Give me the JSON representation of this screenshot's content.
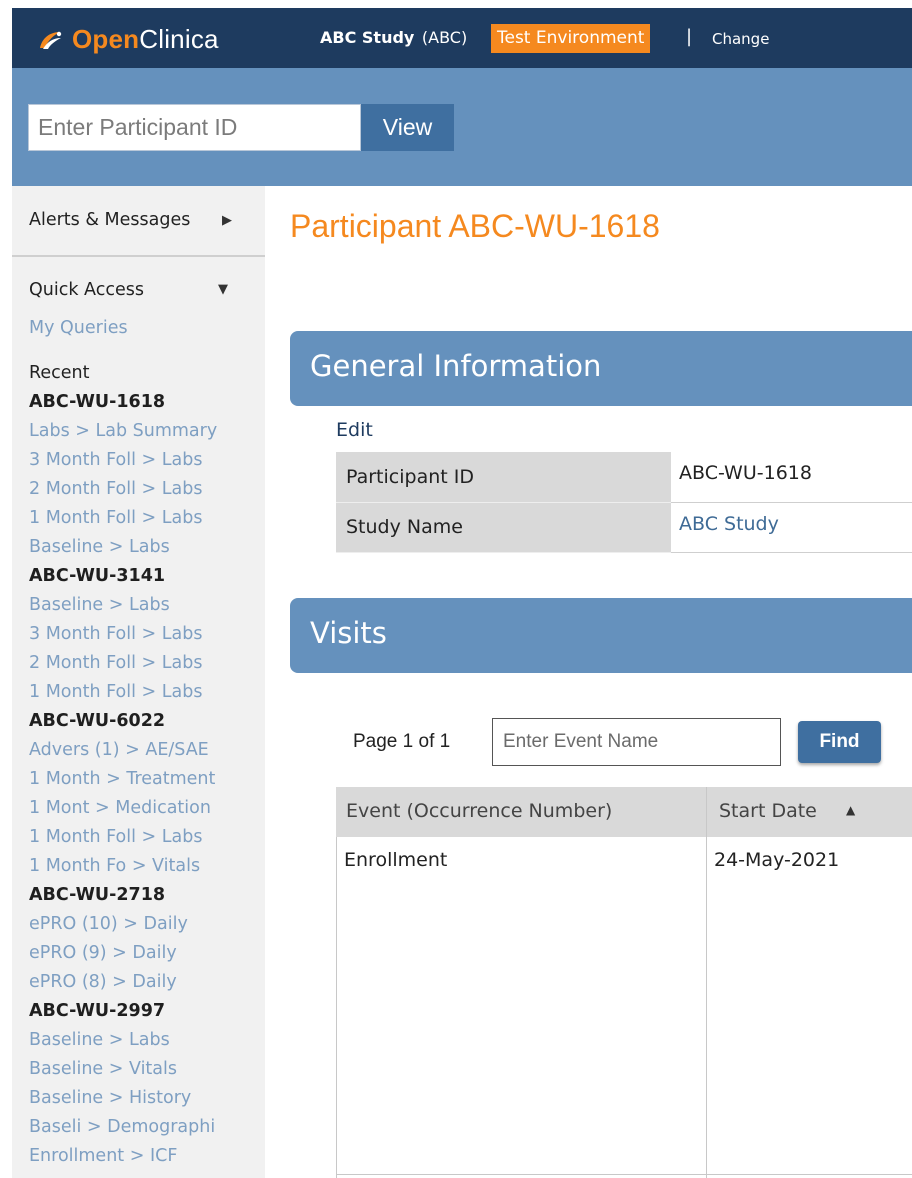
{
  "header": {
    "logo_open": "Open",
    "logo_clinica": "Clinica",
    "study_name": "ABC Study",
    "study_code": "(ABC)",
    "environment": "Test Environment",
    "separator": "|",
    "change_label": "Change",
    "bar_color": "#1e3b5f",
    "accent_color": "#f5891f"
  },
  "search": {
    "placeholder": "Enter Participant ID",
    "value": "",
    "view_label": "View"
  },
  "sidebar": {
    "alerts_label": "Alerts & Messages",
    "quick_access_label": "Quick Access",
    "my_queries_label": "My Queries",
    "recent_label": "Recent",
    "recent": [
      {
        "type": "head",
        "text": "ABC-WU-1618"
      },
      {
        "type": "link",
        "text": "Labs > Lab Summary"
      },
      {
        "type": "link",
        "text": "3 Month Foll > Labs"
      },
      {
        "type": "link",
        "text": "2 Month Foll > Labs"
      },
      {
        "type": "link",
        "text": "1 Month Foll > Labs"
      },
      {
        "type": "link",
        "text": "Baseline > Labs"
      },
      {
        "type": "head",
        "text": "ABC-WU-3141"
      },
      {
        "type": "link",
        "text": "Baseline > Labs"
      },
      {
        "type": "link",
        "text": "3 Month Foll > Labs"
      },
      {
        "type": "link",
        "text": "2 Month Foll > Labs"
      },
      {
        "type": "link",
        "text": "1 Month Foll > Labs"
      },
      {
        "type": "head",
        "text": "ABC-WU-6022"
      },
      {
        "type": "link",
        "text": "Advers (1) > AE/SAE"
      },
      {
        "type": "link",
        "text": "1 Month > Treatment"
      },
      {
        "type": "link",
        "text": "1 Mont > Medication"
      },
      {
        "type": "link",
        "text": "1 Month Foll > Labs"
      },
      {
        "type": "link",
        "text": "1 Month Fo > Vitals"
      },
      {
        "type": "head",
        "text": "ABC-WU-2718"
      },
      {
        "type": "link",
        "text": "ePRO (10) > Daily"
      },
      {
        "type": "link",
        "text": "ePRO (9) > Daily"
      },
      {
        "type": "link",
        "text": "ePRO (8) > Daily"
      },
      {
        "type": "head",
        "text": "ABC-WU-2997"
      },
      {
        "type": "link",
        "text": "Baseline > Labs"
      },
      {
        "type": "link",
        "text": "Baseline > Vitals"
      },
      {
        "type": "link",
        "text": "Baseline > History"
      },
      {
        "type": "link",
        "text": "Baseli > Demographi"
      },
      {
        "type": "link",
        "text": "Enrollment > ICF"
      }
    ]
  },
  "main": {
    "page_title": "Participant ABC-WU-1618",
    "general": {
      "title": "General Information",
      "edit_label": "Edit",
      "rows": [
        {
          "label": "Participant ID",
          "value": "ABC-WU-1618"
        },
        {
          "label": "Study Name",
          "value": "ABC Study"
        }
      ]
    },
    "visits": {
      "title": "Visits",
      "page_info": "Page 1 of 1",
      "event_placeholder": "Enter Event Name",
      "find_label": "Find",
      "columns": [
        "Event (Occurrence Number)",
        "Start Date"
      ],
      "rows": [
        {
          "event": "Enrollment",
          "start_date": "24-May-2021"
        }
      ]
    }
  }
}
